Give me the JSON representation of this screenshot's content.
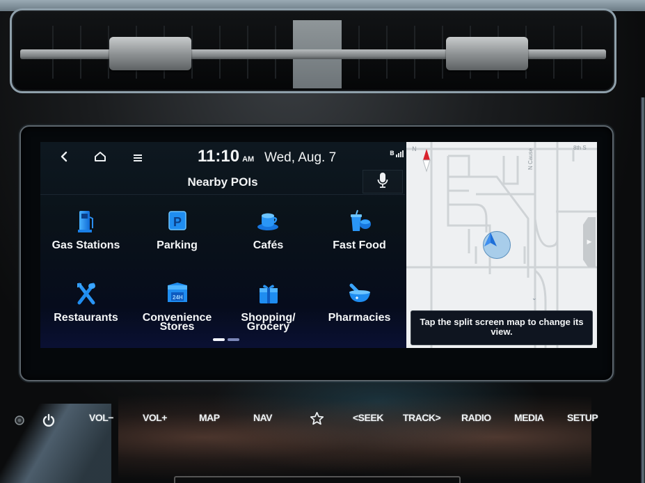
{
  "status_bar": {
    "back_icon": "chevron-left-icon",
    "home_icon": "home-icon",
    "menu_icon": "menu-icon",
    "time": "11:10",
    "ampm": "AM",
    "date": "Wed, Aug. 7",
    "connectivity_icon": "bluetooth-signal-icon"
  },
  "header": {
    "title": "Nearby POIs",
    "mic_icon": "microphone-icon"
  },
  "poi_categories": [
    {
      "label": "Gas Stations",
      "icon": "gas-pump-icon"
    },
    {
      "label": "Parking",
      "icon": "parking-icon"
    },
    {
      "label": "Cafés",
      "icon": "coffee-cup-icon"
    },
    {
      "label": "Fast Food",
      "icon": "fast-food-icon"
    },
    {
      "label": "Restaurants",
      "icon": "fork-spoon-icon"
    },
    {
      "label": "Convenience\nStores",
      "icon": "convenience-store-icon"
    },
    {
      "label": "Shopping/\nGrocery",
      "icon": "gift-box-icon"
    },
    {
      "label": "Pharmacies",
      "icon": "mortar-pestle-icon"
    }
  ],
  "pagination": {
    "current_page": 1,
    "total_pages": 2
  },
  "map": {
    "compass_label": "N",
    "street_labels": [
      "N Cause",
      "8th S"
    ],
    "hint": "Tap the split screen map to change its view.",
    "accent_color": "#1e6fd8",
    "compass_color": "#d9232e"
  },
  "hardkeys": {
    "buttons": [
      "VOL−",
      "VOL+",
      "MAP",
      "NAV",
      "<SEEK",
      "TRACK>",
      "RADIO",
      "MEDIA",
      "SETUP"
    ],
    "power_icon": "power-icon",
    "favorite_icon": "star-icon",
    "sensor_icon": "light-sensor-icon"
  },
  "colors": {
    "icon_blue": "#1f8df0",
    "text": "#f2f4f5",
    "screen_bg": "#0a1219"
  }
}
